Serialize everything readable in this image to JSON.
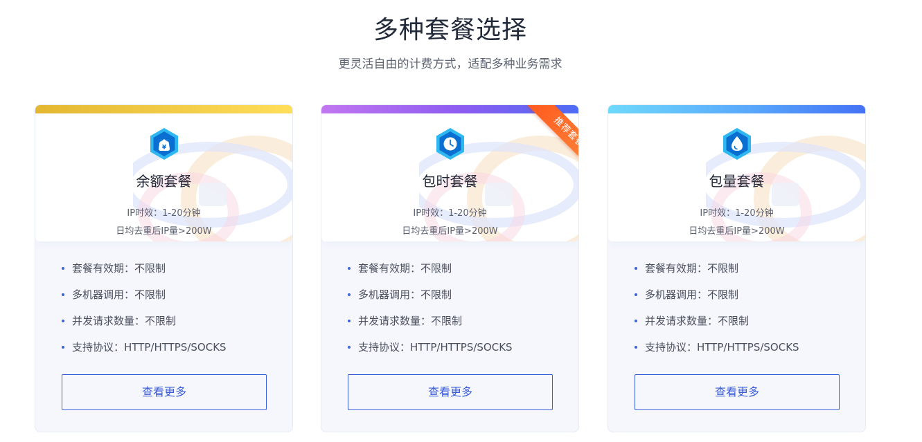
{
  "section": {
    "title": "多种套餐选择",
    "subtitle": "更灵活自由的计费方式，适配多种业务需求"
  },
  "plans": [
    {
      "name": "余额套餐",
      "icon": "yen-money-bag-icon",
      "accent": "#e4b730",
      "line1": "IP时效：1-20分钟",
      "line2": "日均去重后IP量>200W",
      "features": [
        "套餐有效期：不限制",
        "多机器调用：不限制",
        "并发请求数量：不限制",
        "支持协议：HTTP/HTTPS/SOCKS"
      ],
      "button": "查看更多"
    },
    {
      "name": "包时套餐",
      "icon": "clock-icon",
      "accent": "#8b5cf0",
      "badge": "推荐套餐",
      "line1": "IP时效：1-20分钟",
      "line2": "日均去重后IP量>200W",
      "features": [
        "套餐有效期：不限制",
        "多机器调用：不限制",
        "并发请求数量：不限制",
        "支持协议：HTTP/HTTPS/SOCKS"
      ],
      "button": "查看更多"
    },
    {
      "name": "包量套餐",
      "icon": "water-drop-icon",
      "accent": "#4472f5",
      "line1": "IP时效：1-20分钟",
      "line2": "日均去重后IP量>200W",
      "features": [
        "套餐有效期：不限制",
        "多机器调用：不限制",
        "并发请求数量：不限制",
        "支持协议：HTTP/HTTPS/SOCKS"
      ],
      "button": "查看更多"
    }
  ]
}
